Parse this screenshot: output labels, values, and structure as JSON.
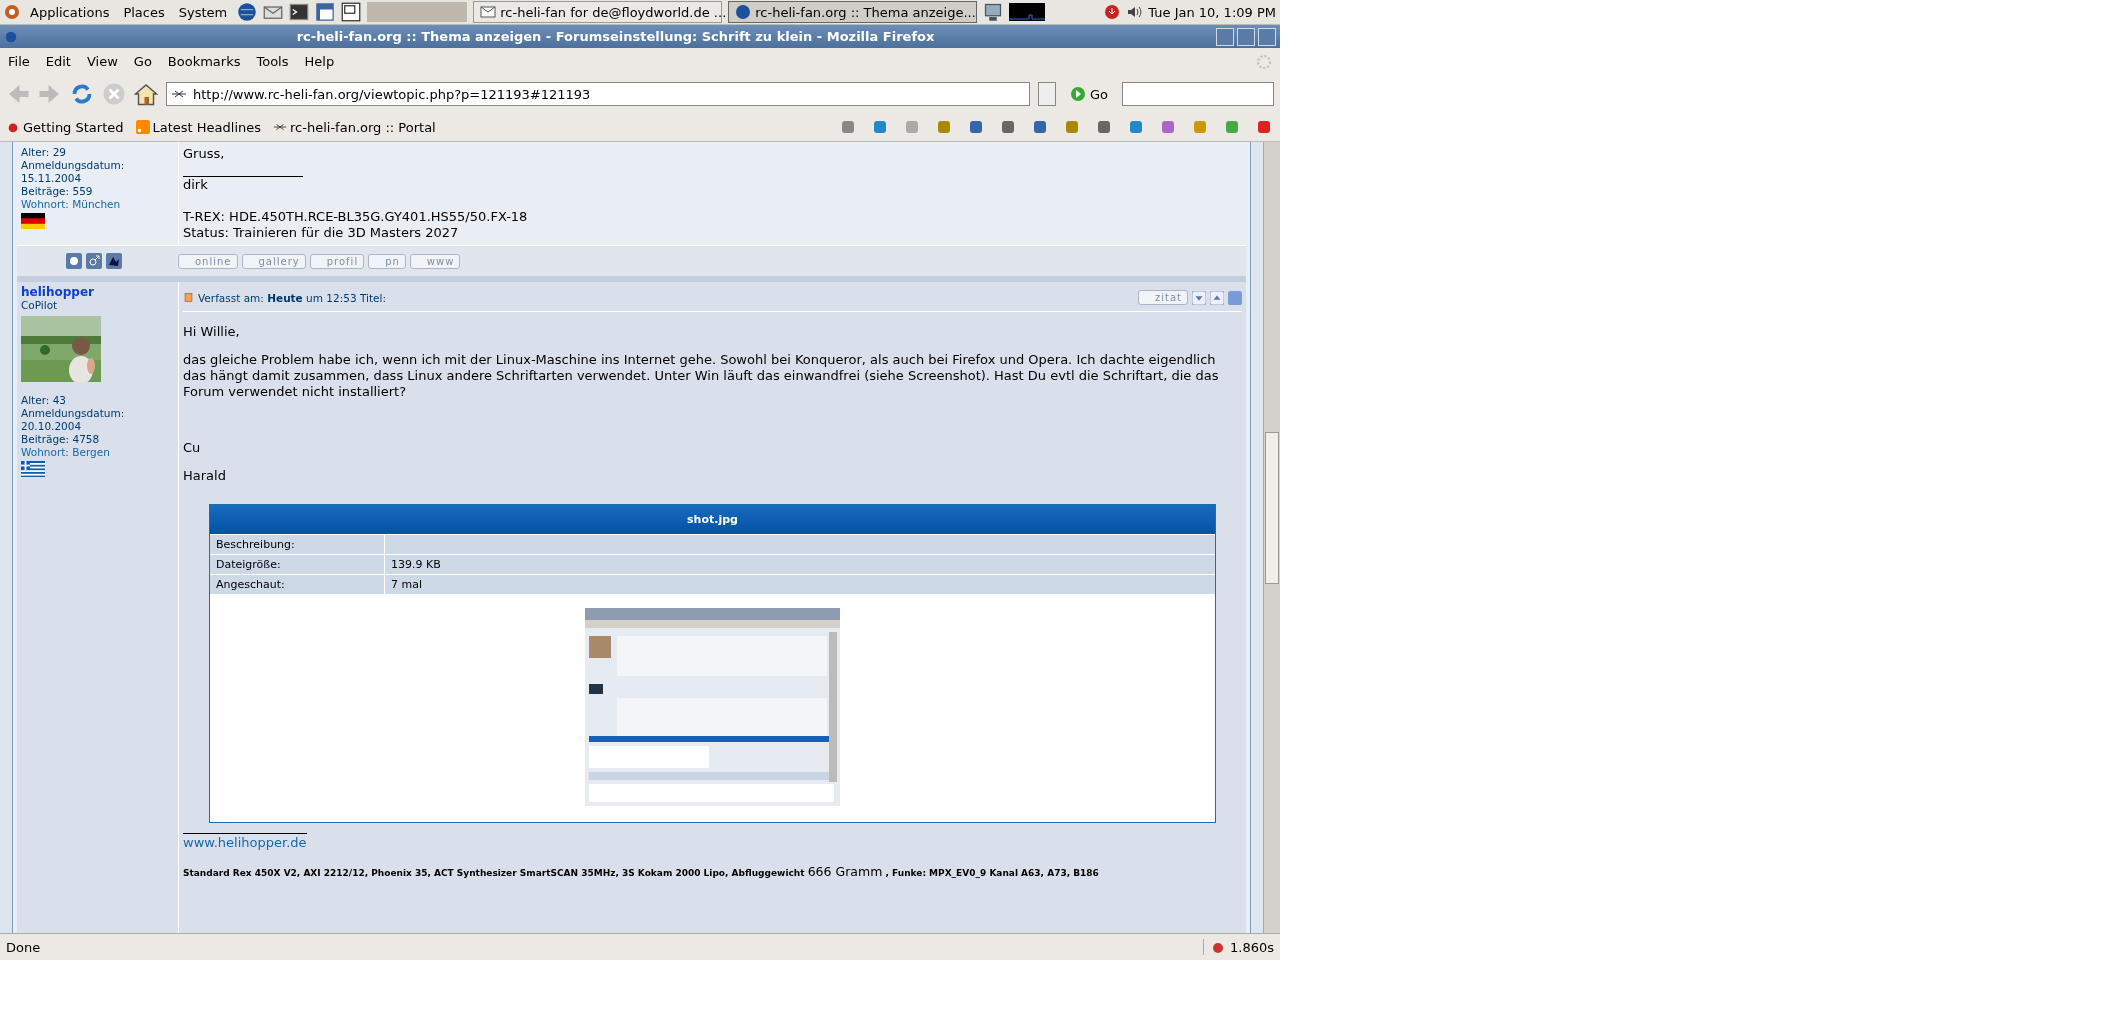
{
  "panel": {
    "menus": [
      "Applications",
      "Places",
      "System"
    ],
    "tasks": [
      {
        "label": "rc-heli-fan for de@floydworld.de ...",
        "selected": false
      },
      {
        "label": "rc-heli-fan.org :: Thema anzeige...",
        "selected": true
      }
    ],
    "clock": "Tue Jan 10,  1:09 PM"
  },
  "window": {
    "title": "rc-heli-fan.org :: Thema anzeigen - Forumseinstellung: Schrift zu klein - Mozilla Firefox"
  },
  "menu": [
    "File",
    "Edit",
    "View",
    "Go",
    "Bookmarks",
    "Tools",
    "Help"
  ],
  "toolbar": {
    "url": "http://www.rc-heli-fan.org/viewtopic.php?p=121193#121193",
    "go": "Go"
  },
  "bookmarks": [
    "Getting Started",
    "Latest Headlines",
    "rc-heli-fan.org :: Portal"
  ],
  "post1": {
    "info": [
      "Alter: 29",
      "Anmeldungsdatum:",
      "15.11.2004",
      "Beiträge: 559"
    ],
    "location": "Wohnort: München",
    "flag": {
      "kind": "de"
    },
    "lines": [
      "Gruss,",
      "dirk",
      "T-REX: HDE.450TH.RCE-BL35G.GY401.HS55/50.FX-18",
      "Status: Trainieren für die 3D Masters 2027"
    ],
    "buttons": [
      "online",
      "gallery",
      "profil",
      "pn",
      "www"
    ]
  },
  "post2": {
    "name": "helihopper",
    "rank": "CoPilot",
    "info": [
      "Alter: 43",
      "Anmeldungsdatum:",
      "20.10.2004",
      "Beiträge: 4758"
    ],
    "location": "Wohnort: Bergen",
    "flag": {
      "kind": "gr"
    },
    "header": "Verfasst am: **Heute** um 12:53  Titel:",
    "quote": "zitat",
    "paragraphs": [
      "Hi Willie,",
      "das gleiche Problem habe ich, wenn ich mit der Linux-Maschine ins Internet gehe. Sowohl bei Konqueror, als auch bei Firefox und Opera. Ich dachte eigendlich das hängt damit zusammen, dass Linux andere Schriftarten verwendet. Unter Win läuft das einwandfrei (siehe Screenshot). Hast Du evtl die Schriftart, die das Forum verwendet nicht installiert?",
      "Cu",
      "Harald"
    ],
    "attachment": {
      "title": "shot.jpg",
      "rows": [
        {
          "label": "Beschreibung:"
        },
        {
          "label": "Dateigröße:",
          "value": "139.9 KB"
        },
        {
          "label": "Angeschaut:",
          "value": "7 mal"
        }
      ]
    },
    "link": "www.helihopper.de",
    "signature": {
      "before": "Standard Rex 450X V2, AXI 2212/12, Phoenix 35, ACT Synthesizer SmartSCAN 35MHz, 3S Kokam 2000 Lipo, Abfluggewicht",
      "emphasis": "666 Gramm",
      "after": ", Funke: MPX_EV0_9 Kanal A63, A73, B186"
    }
  },
  "status": {
    "text": "Done",
    "time": "1.860s"
  }
}
